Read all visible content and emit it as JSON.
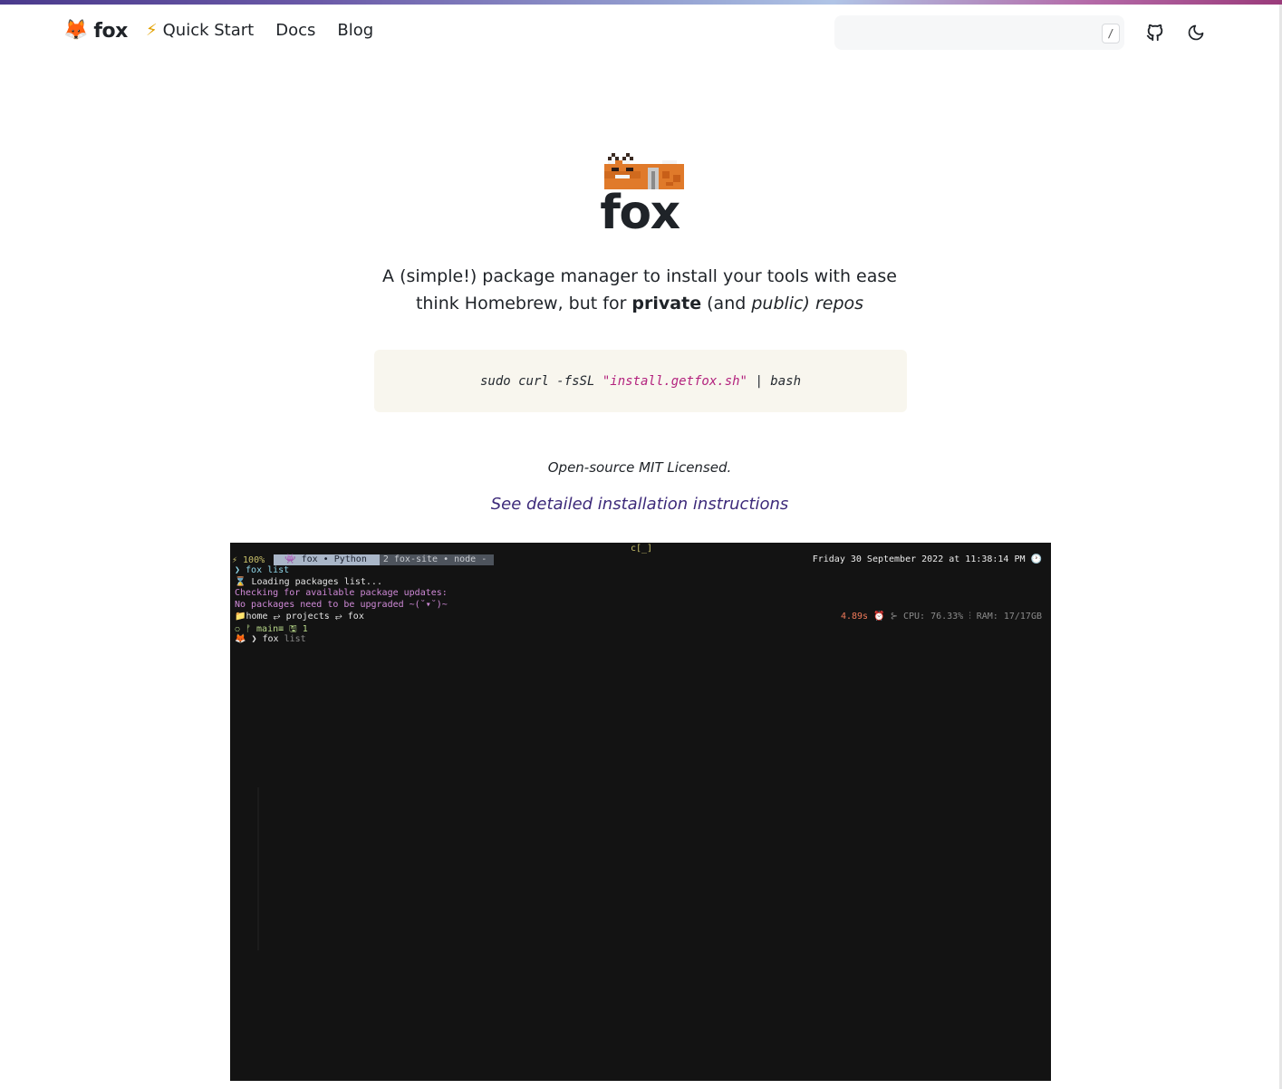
{
  "nav": {
    "brand_emoji": "🦊",
    "brand_text": "fox",
    "quickstart_icon": "⚡",
    "quickstart_label": "Quick Start",
    "docs_label": "Docs",
    "blog_label": "Blog",
    "search_placeholder": "",
    "search_shortcut": "/",
    "github_icon": "github-icon",
    "theme_icon": "moon-icon"
  },
  "hero": {
    "title": "fox",
    "tagline_line1": "A (simple!) package manager to install your tools with ease",
    "tagline_prefix": "think Homebrew, but for ",
    "tagline_bold": "private",
    "tagline_mid": " (and ",
    "tagline_italic": "public) repos"
  },
  "install": {
    "cmd_prefix": "sudo curl -fsSL",
    "cmd_string": "\"install.getfox.sh\"",
    "cmd_suffix": "| bash"
  },
  "license_text": "Open-source MIT Licensed.",
  "install_link_text": "See detailed installation instructions",
  "terminal": {
    "top_center": "c[_]",
    "battery": "⚡ 100%",
    "tab_active": "👾 fox • Python",
    "tab_inactive": "2 fox-site • node -",
    "datetime": "Friday 30 September 2022 at 11:38:14 PM 🕐",
    "lines": [
      {
        "text": "❯ fox list",
        "color": "c-cyan"
      },
      {
        "text": "⌛ Loading packages list...",
        "color": "c-white"
      },
      {
        "text": "Checking for available package updates:",
        "color": "c-magenta"
      },
      {
        "text": "No packages need to be upgraded ~(˘▾˘)~",
        "color": "c-magenta"
      },
      {
        "text": "📁home ⥂ projects ⥂ fox",
        "color": "c-white"
      },
      {
        "text": "⎔ ᚠ main≡ 🖫 1",
        "color": "c-green"
      }
    ],
    "prompt_prefix": "🦊 ❯ fox",
    "prompt_suggest": " list",
    "stat_time": "4.89s",
    "stat_rest": "⏰ ⊱ CPU: 76.33% ⫶ RAM: 17/17GB"
  }
}
